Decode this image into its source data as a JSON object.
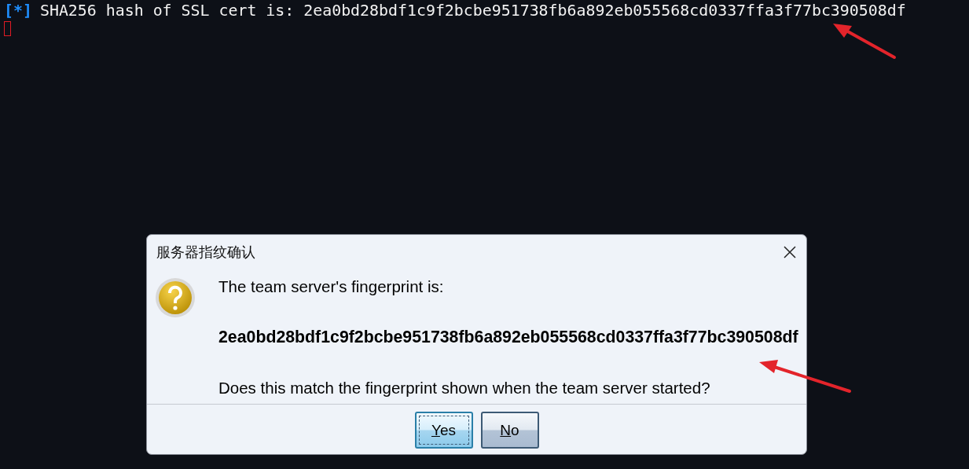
{
  "terminal": {
    "lines": [
      {
        "prefix": "[*]",
        "text": "SHA256 hash of SSL cert is: 2ea0bd28bdf1c9f2bcbe951738fb6a892eb055568cd0337ffa3f77bc390508df"
      }
    ],
    "cursor": true
  },
  "dialog": {
    "title": "服务器指纹确认",
    "kind": "question",
    "message": "The team server's fingerprint is:",
    "fingerprint": "2ea0bd28bdf1c9f2bcbe951738fb6a892eb055568cd0337ffa3f77bc390508df",
    "question": "Does this match the fingerprint shown when the team server started?",
    "buttons": [
      {
        "label": "Yes",
        "selected": true
      },
      {
        "label": "No",
        "selected": false
      }
    ]
  }
}
